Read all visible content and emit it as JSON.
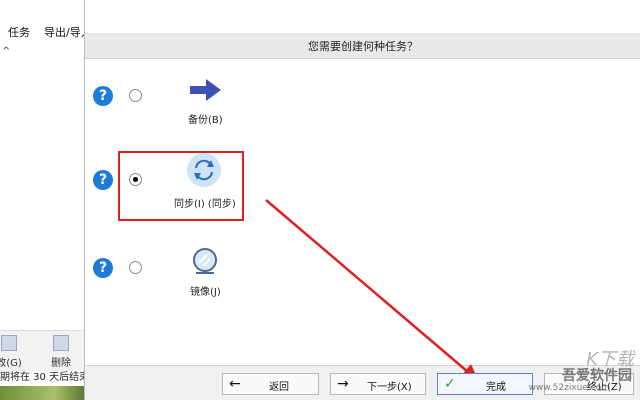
{
  "background_app": {
    "menu": [
      "任务",
      "导出/导入"
    ],
    "toolbar": [
      {
        "label": "改(G)",
        "icon": "edit-icon"
      },
      {
        "label": "删除",
        "icon": "delete-icon"
      }
    ],
    "status": "期将在 30 天后结束"
  },
  "dialog": {
    "header": "您需要创建何种任务？",
    "options": [
      {
        "label": "备份(B)",
        "icon": "backup-arrow-icon",
        "selected": false
      },
      {
        "label": "同步(I) (同步)",
        "icon": "sync-icon",
        "selected": true
      },
      {
        "label": "镜像(J)",
        "icon": "mirror-icon",
        "selected": false
      }
    ],
    "buttons": {
      "back": "返回",
      "next": "下一步(X)",
      "finish": "完成",
      "cancel": "终止(Z)"
    }
  },
  "watermark": {
    "line1": "K下载",
    "line2": "吾爱软件园",
    "line3": "www.52zixue.com"
  },
  "colors": {
    "accent": "#1e7bd6",
    "highlight": "#e02020",
    "arrow": "#e02020"
  }
}
